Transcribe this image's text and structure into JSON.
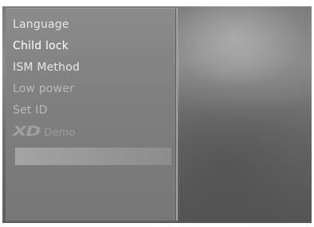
{
  "menu": {
    "items": [
      {
        "label": "Language"
      },
      {
        "label": "Child lock"
      },
      {
        "label": "ISM Method"
      },
      {
        "label": "Low power"
      },
      {
        "label": "Set ID"
      },
      {
        "label": "Demo",
        "logo": "XD"
      }
    ]
  },
  "colors": {
    "panel": "#808080",
    "text_active": "#ffffff",
    "text_disabled": "#9c9c9c",
    "selection": "#9a9a9a"
  },
  "icons": {
    "xd_logo": "xd-logo-icon"
  }
}
